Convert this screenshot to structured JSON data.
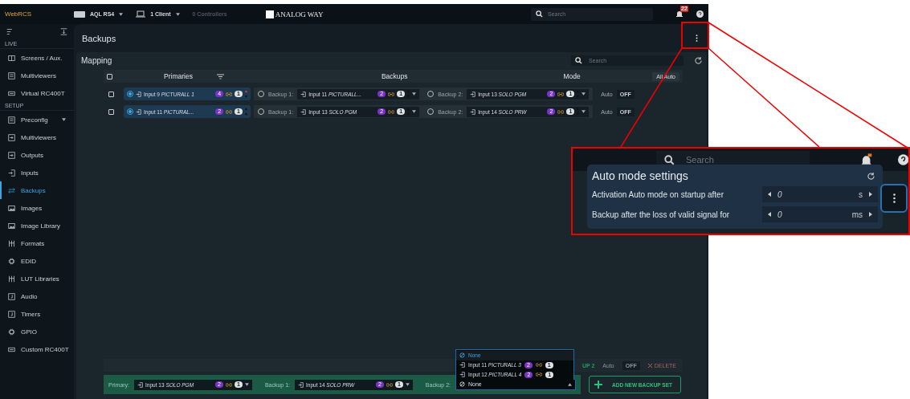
{
  "top_bar": {
    "logo": "WebRCS",
    "device": "AQL RS4",
    "clients": "1 Client",
    "controllers": {
      "label": "0 Controllers",
      "disabled": true
    },
    "brand": "ANALOG WAY",
    "search": {
      "placeholder": "Search"
    },
    "notifications": "22"
  },
  "sidebar": {
    "sections": [
      {
        "title": "LIVE",
        "items": [
          {
            "label": "Screens / Aux.",
            "kind": "panel",
            "selected": false
          },
          {
            "label": "Multiviewers",
            "kind": "grid",
            "selected": false
          },
          {
            "label": "Virtual RC400T",
            "kind": "console",
            "selected": false
          }
        ]
      },
      {
        "title": "SETUP",
        "items": [
          {
            "label": "Preconfig",
            "kind": "grid",
            "selected": false,
            "expandable": true
          },
          {
            "label": "Multiviewers",
            "kind": "output",
            "selected": false
          },
          {
            "label": "Outputs",
            "kind": "output",
            "selected": false
          },
          {
            "label": "Inputs",
            "kind": "input",
            "selected": false
          },
          {
            "label": "Backups",
            "kind": "swap",
            "selected": true
          },
          {
            "label": "Images",
            "kind": "image",
            "selected": false
          },
          {
            "label": "Image Library",
            "kind": "image",
            "selected": false
          },
          {
            "label": "Formats",
            "kind": "formats",
            "selected": false
          },
          {
            "label": "EDID",
            "kind": "chip",
            "selected": false
          },
          {
            "label": "LUT Libraries",
            "kind": "formats",
            "selected": false
          },
          {
            "label": "Audio",
            "kind": "note",
            "selected": false
          },
          {
            "label": "Timers",
            "kind": "note",
            "selected": false
          },
          {
            "label": "GPIO",
            "kind": "chip",
            "selected": false
          },
          {
            "label": "Custom RC400T",
            "kind": "console",
            "selected": false
          }
        ]
      }
    ]
  },
  "page": {
    "title": "Backups"
  },
  "mapping": {
    "title": "Mapping",
    "search": {
      "placeholder": "Search"
    },
    "header_checked": false,
    "columns": {
      "primaries": "Primaries",
      "backups": "Backups",
      "mode": "Mode"
    },
    "all_auto": "All Auto",
    "rows": [
      {
        "checked": false,
        "primary": {
          "selected": true,
          "text": "Input 9 *PICTURALL 1*",
          "layers": "4",
          "slots": "1",
          "alert": true
        },
        "backups": [
          {
            "label": "Backup 1:",
            "selected": false,
            "text": "Input 11 *PICTURALL...*",
            "layers": "2",
            "slots": "1",
            "alert": false
          },
          {
            "label": "Backup 2:",
            "selected": false,
            "text": "Input 13 *SOLO PGM*",
            "layers": "2",
            "slots": "1",
            "alert": false
          }
        ],
        "mode": {
          "label": "Auto",
          "value": "OFF"
        }
      },
      {
        "checked": false,
        "primary": {
          "selected": true,
          "text": "Input 11 *PICTURAL...*",
          "layers": "2",
          "slots": "1",
          "alert": false
        },
        "backups": [
          {
            "label": "Backup 1:",
            "selected": false,
            "text": "Input 13 *SOLO PGM*",
            "layers": "2",
            "slots": "1",
            "alert": false
          },
          {
            "label": "Backup 2:",
            "selected": false,
            "text": "Input 14 *SOLO PRW*",
            "layers": "2",
            "slots": "1",
            "alert": false
          }
        ],
        "mode": {
          "label": "Auto",
          "value": "OFF"
        }
      }
    ],
    "partial_row": {
      "backup_label": "UP 2",
      "mode_label": "Auto",
      "mode_value": "OFF",
      "delete": "DELETE"
    },
    "new_set": {
      "primary": {
        "label": "Primary:",
        "text": "Input 13 *SOLO PGM*",
        "layers": "2",
        "slots": "1"
      },
      "backup_1": {
        "label": "Backup 1:",
        "text": "Input 14 *SOLO PRW*",
        "layers": "2",
        "slots": "1"
      },
      "backup_2": {
        "label": "Backup 2:",
        "value": "None"
      },
      "dropdown": [
        {
          "kind": "none",
          "text": "None",
          "selected": true
        },
        {
          "kind": "input",
          "text": "Input 11 *PICTURALL 3*",
          "layers": "2",
          "slots": "1",
          "selected": false
        },
        {
          "kind": "input",
          "text": "Input 12 *PICTURALL 4*",
          "layers": "2",
          "slots": "1",
          "selected": false
        }
      ],
      "add_button": "ADD NEW BACKUP SET"
    }
  },
  "zoom_inset": {
    "search": {
      "placeholder": "Search"
    },
    "popup": {
      "title": "Auto mode settings",
      "settings": [
        {
          "label": "Activation Auto mode on startup after",
          "value": "0",
          "unit": "s"
        },
        {
          "label": "Backup after the loss of valid signal for",
          "value": "0",
          "unit": "ms"
        }
      ]
    }
  }
}
